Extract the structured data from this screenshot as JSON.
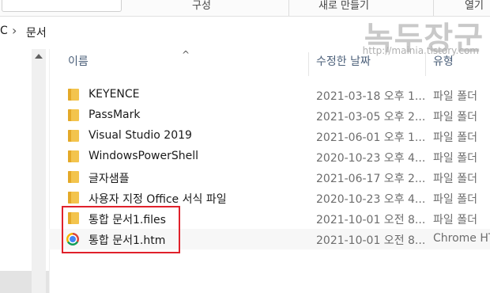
{
  "ribbon": {
    "group1": "구성",
    "group2": "새로 만들기",
    "group3": "열기"
  },
  "address": {
    "prev_crumb": "C",
    "current_crumb": "문서"
  },
  "watermark": {
    "title": "녹두장군",
    "url": "http://mainia.tistory.com"
  },
  "columns": {
    "name": "이름",
    "date": "수정한 날짜",
    "type": "유형"
  },
  "files": [
    {
      "icon": "folder-icon",
      "name": "KEYENCE",
      "date": "2021-03-18 오후 1...",
      "type": "파일 폴더"
    },
    {
      "icon": "folder-icon",
      "name": "PassMark",
      "date": "2021-03-05 오후 2...",
      "type": "파일 폴더"
    },
    {
      "icon": "folder-icon",
      "name": "Visual Studio 2019",
      "date": "2021-06-01 오후 1...",
      "type": "파일 폴더"
    },
    {
      "icon": "folder-icon",
      "name": "WindowsPowerShell",
      "date": "2020-10-23 오후 4...",
      "type": "파일 폴더"
    },
    {
      "icon": "folder-icon",
      "name": "글자샘플",
      "date": "2021-06-17 오후 2...",
      "type": "파일 폴더"
    },
    {
      "icon": "folder-icon",
      "name": "사용자 지정 Office 서식 파일",
      "date": "2020-10-23 오후 4...",
      "type": "파일 폴더"
    },
    {
      "icon": "folder-icon",
      "name": "통합 문서1.files",
      "date": "2021-10-01 오전 8...",
      "type": "파일 폴더"
    },
    {
      "icon": "chrome-icon",
      "name": "통합 문서1.htm",
      "date": "2021-10-01 오전 8...",
      "type": "Chrome HTML"
    }
  ],
  "colors": {
    "highlight": "#e0212b",
    "folder": "#f3c44d",
    "header_text": "#4c607a"
  }
}
